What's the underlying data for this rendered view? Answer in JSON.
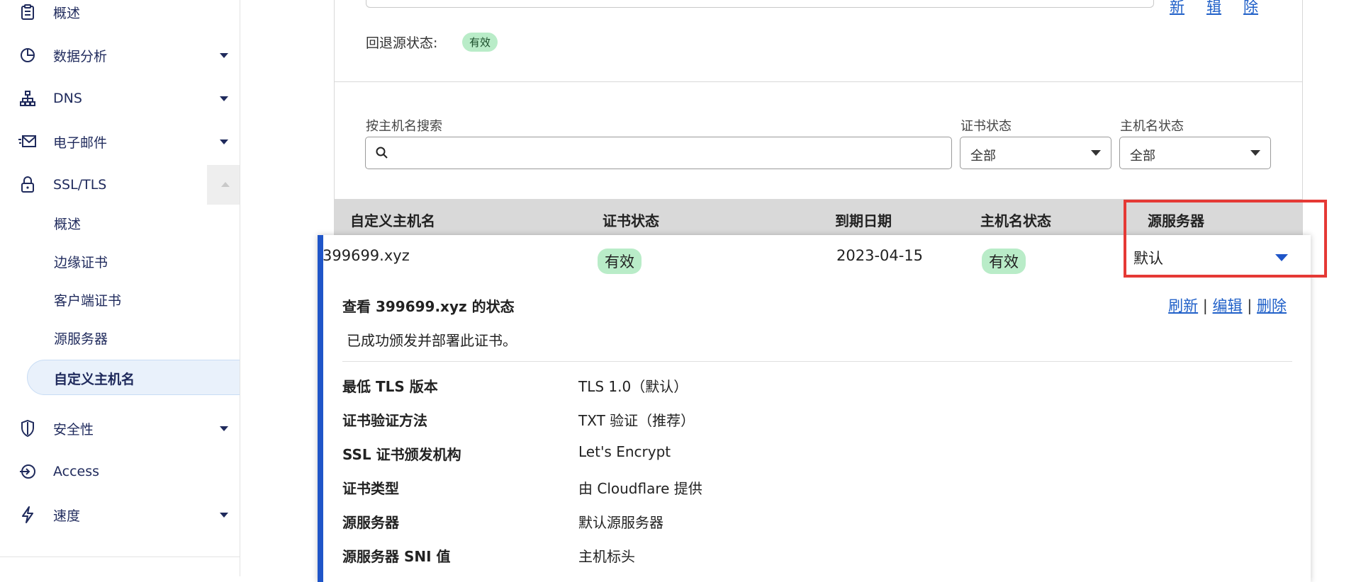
{
  "sidebar": {
    "items": [
      {
        "label": "概述",
        "icon": "clipboard-icon"
      },
      {
        "label": "数据分析",
        "icon": "pie-chart-icon"
      },
      {
        "label": "DNS",
        "icon": "network-icon"
      },
      {
        "label": "电子邮件",
        "icon": "mail-icon"
      },
      {
        "label": "SSL/TLS",
        "icon": "lock-icon"
      },
      {
        "label": "安全性",
        "icon": "shield-icon"
      },
      {
        "label": "Access",
        "icon": "access-icon"
      },
      {
        "label": "速度",
        "icon": "lightning-icon"
      }
    ],
    "ssl_subitems": [
      "概述",
      "边缘证书",
      "客户端证书",
      "源服务器",
      "自定义主机名"
    ],
    "active_subitem": "自定义主机名"
  },
  "top_links": [
    "新",
    "辑",
    "除"
  ],
  "fallback": {
    "label": "回退源状态:",
    "status": "有效"
  },
  "filters": {
    "search_label": "按主机名搜索",
    "search_value": "",
    "cert_status_label": "证书状态",
    "cert_status_value": "全部",
    "hostname_status_label": "主机名状态",
    "hostname_status_value": "全部"
  },
  "table": {
    "headers": [
      "自定义主机名",
      "证书状态",
      "到期日期",
      "主机名状态",
      "源服务器"
    ],
    "row": {
      "hostname": "399699.xyz",
      "cert_status": "有效",
      "expiry": "2023-04-15",
      "hostname_status": "有效",
      "origin": "默认"
    }
  },
  "detail": {
    "title": "查看 399699.xyz 的状态",
    "links": [
      "刷新",
      "编辑",
      "删除"
    ],
    "separator": "|",
    "description": "已成功颁发并部署此证书。",
    "rows": [
      {
        "key": "最低 TLS 版本",
        "value": "TLS 1.0（默认）"
      },
      {
        "key": "证书验证方法",
        "value": "TXT 验证（推荐）"
      },
      {
        "key": "SSL 证书颁发机构",
        "value": "Let's Encrypt"
      },
      {
        "key": "证书类型",
        "value": "由 Cloudflare 提供"
      },
      {
        "key": "源服务器",
        "value": "默认源服务器"
      },
      {
        "key": "源服务器 SNI 值",
        "value": "主机标头"
      }
    ]
  },
  "colors": {
    "accent": "#1f55c8",
    "link": "#2060c8",
    "badge": "#b9ecc8",
    "highlight": "#e53935"
  }
}
